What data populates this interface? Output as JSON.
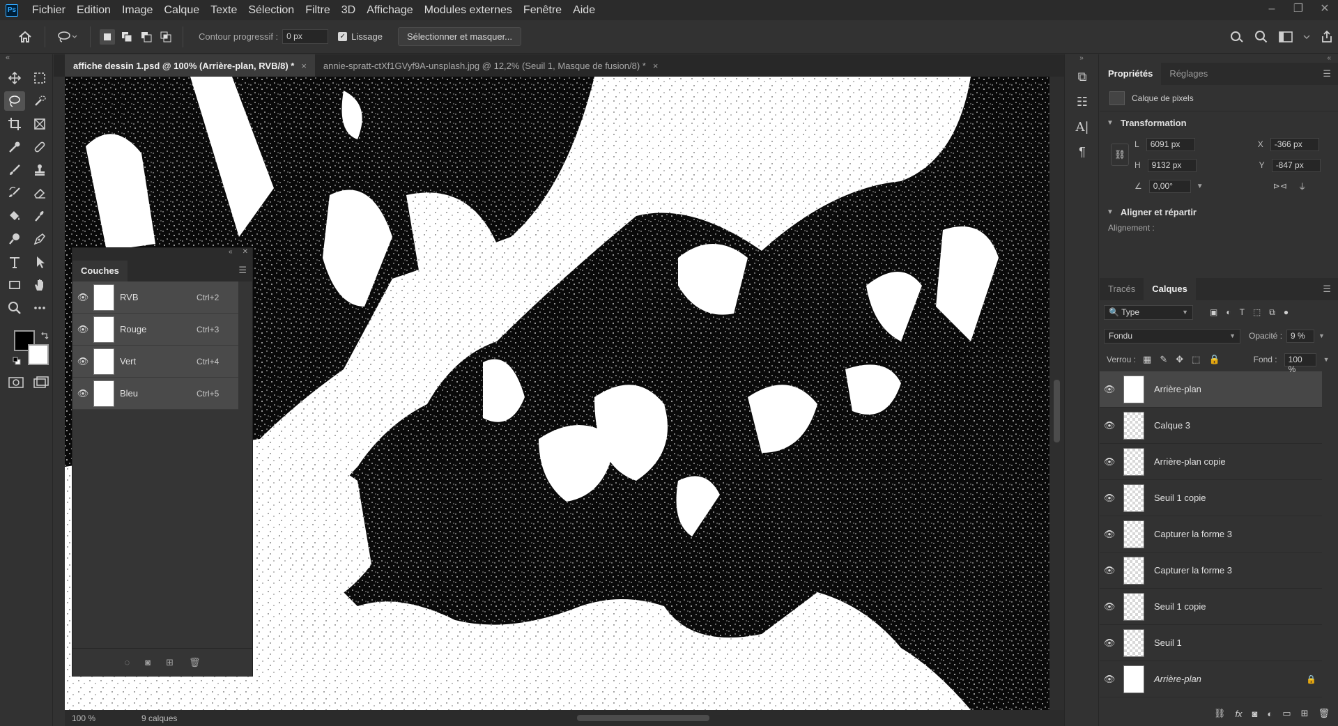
{
  "menu": {
    "logo": "Ps",
    "items": [
      "Fichier",
      "Edition",
      "Image",
      "Calque",
      "Texte",
      "Sélection",
      "Filtre",
      "3D",
      "Affichage",
      "Modules externes",
      "Fenêtre",
      "Aide"
    ]
  },
  "window_controls": {
    "minimize": "–",
    "restore": "❐",
    "close": "✕"
  },
  "options": {
    "feather_label": "Contour progressif :",
    "feather_value": "0 px",
    "smoothing_label": "Lissage",
    "smoothing_checked": true,
    "select_mask_button": "Sélectionner et masquer..."
  },
  "tabs": [
    {
      "label": "affiche dessin 1.psd @ 100% (Arrière-plan, RVB/8) *",
      "active": true
    },
    {
      "label": "annie-spratt-ctXf1GVyf9A-unsplash.jpg @ 12,2% (Seuil 1, Masque de fusion/8) *",
      "active": false
    }
  ],
  "tab_close": "×",
  "toolbar": {
    "tools": [
      "move-tool",
      "marquee-tool",
      "lasso-tool",
      "quick-select-tool",
      "crop-tool",
      "frame-tool",
      "eyedropper-tool",
      "healing-tool",
      "brush-tool",
      "stamp-tool",
      "history-brush-tool",
      "eraser-tool",
      "bucket-tool",
      "smudge-tool",
      "dodge-tool",
      "pen-tool",
      "type-tool",
      "path-select-tool",
      "shape-tool",
      "hand-tool",
      "zoom-tool",
      "more-tools"
    ],
    "active_tool": "lasso-tool",
    "foreground_color": "#000000",
    "background_color": "#ffffff"
  },
  "status": {
    "zoom": "100 %",
    "layer_count": "9 calques"
  },
  "channels": {
    "title": "Couches",
    "rows": [
      {
        "name": "RVB",
        "shortcut": "Ctrl+2"
      },
      {
        "name": "Rouge",
        "shortcut": "Ctrl+3"
      },
      {
        "name": "Vert",
        "shortcut": "Ctrl+4"
      },
      {
        "name": "Bleu",
        "shortcut": "Ctrl+5"
      }
    ]
  },
  "properties": {
    "tabs": [
      "Propriétés",
      "Réglages"
    ],
    "kind": "Calque de pixels",
    "transform_title": "Transformation",
    "w_label": "L",
    "w_value": "6091 px",
    "h_label": "H",
    "h_value": "9132 px",
    "x_label": "X",
    "x_value": "-366 px",
    "y_label": "Y",
    "y_value": "-847 px",
    "angle_value": "0,00°",
    "align_title": "Aligner et répartir",
    "align_sub": "Alignement :"
  },
  "layers": {
    "tabs": [
      "Tracés",
      "Calques"
    ],
    "filter": "Type",
    "blend_mode": "Fondu",
    "opacity_label": "Opacité :",
    "opacity_value": "9 %",
    "lock_label": "Verrou :",
    "fill_label": "Fond :",
    "fill_value": "100 %",
    "items": [
      {
        "name": "Arrière-plan",
        "selected": true
      },
      {
        "name": "Calque 3"
      },
      {
        "name": "Arrière-plan copie"
      },
      {
        "name": "Seuil 1 copie"
      },
      {
        "name": "Capturer la forme 3"
      },
      {
        "name": "Capturer la forme 3"
      },
      {
        "name": "Seuil 1 copie"
      },
      {
        "name": "Seuil 1"
      },
      {
        "name": "Arrière-plan",
        "italic": true,
        "locked": true
      }
    ]
  },
  "icons": {
    "home": "home-icon",
    "lasso": "lasso-icon",
    "search": "search-icon",
    "share": "share-icon",
    "eye": "eye-icon",
    "lock": "lock-icon",
    "link": "link-icon",
    "menu": "panel-menu-icon"
  }
}
